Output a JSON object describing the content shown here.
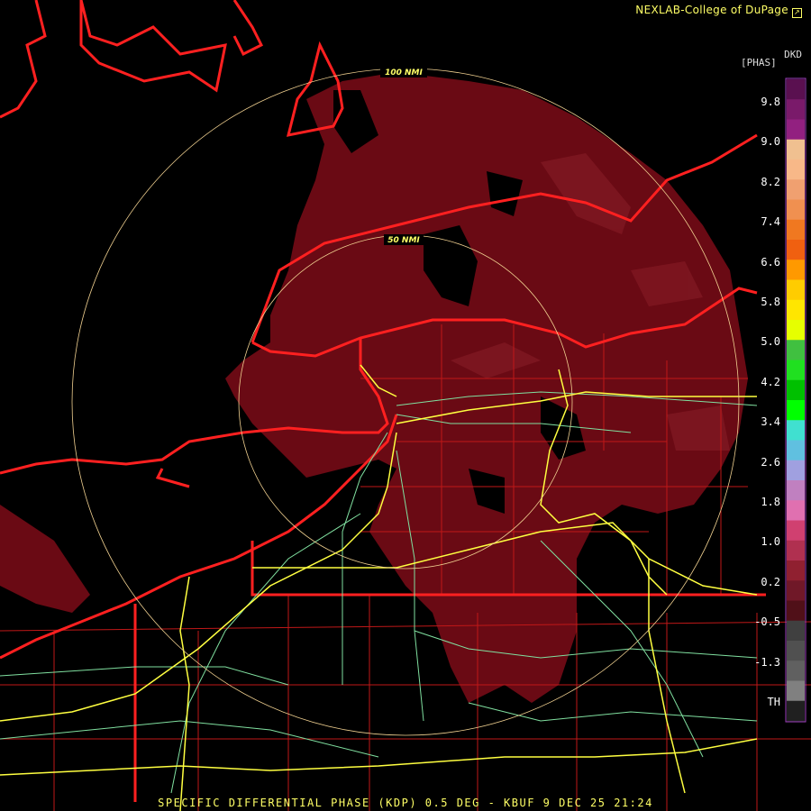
{
  "header": {
    "credit": "NEXLAB-College of DuPage",
    "credit_icon": "corner-arrow-icon"
  },
  "footer": {
    "caption": "SPECIFIC DIFFERENTIAL PHASE (KDP) 0.5 DEG - KBUF 9 DEC 25 21:24"
  },
  "rings": {
    "inner": "50 NMI",
    "outer": "100 NMI"
  },
  "legend": {
    "product": "DKD",
    "units": "[PHAS]",
    "labels": [
      "9.8",
      "9.0",
      "8.2",
      "7.4",
      "6.6",
      "5.8",
      "5.0",
      "4.2",
      "3.4",
      "2.6",
      "1.8",
      "1.0",
      "0.2",
      "-0.5",
      "-1.3",
      "TH"
    ],
    "colors": [
      "#5a1050",
      "#7a1a6a",
      "#922080",
      "#f0c090",
      "#f8b888",
      "#f0a070",
      "#f09050",
      "#f07820",
      "#f06010",
      "#ff9900",
      "#ffcc00",
      "#ffe600",
      "#e6ff00",
      "#40c040",
      "#20e020",
      "#00c000",
      "#00ff00",
      "#40e0d0",
      "#60c0e0",
      "#a0a0e0",
      "#c080c0",
      "#e070b0",
      "#d04070",
      "#b03050",
      "#902030",
      "#701828",
      "#501018",
      "#404040",
      "#505050",
      "#606060",
      "#808080",
      "#202020"
    ]
  },
  "colors": {
    "echo": "#6a0a14",
    "echo_light": "#7d1620",
    "border": "#ff2020",
    "county": "#c01818",
    "highway": "#ffff40",
    "road": "#80e0a0",
    "ring": "#f0d090"
  }
}
